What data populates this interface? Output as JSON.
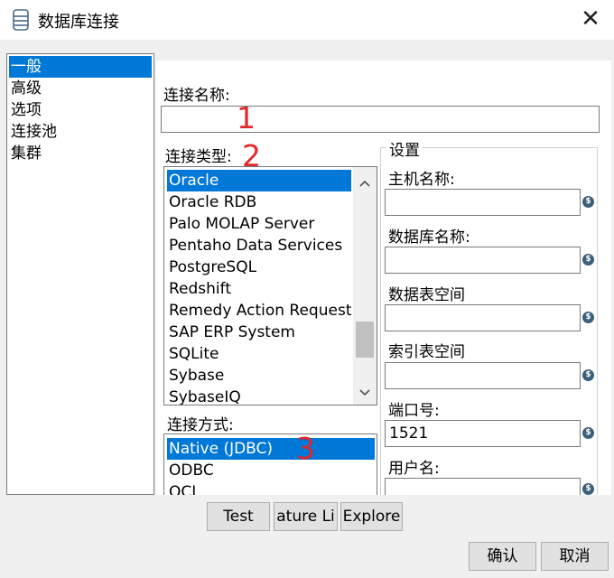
{
  "window": {
    "title": "数据库连接",
    "close_glyph": "✕"
  },
  "categories": [
    {
      "label": "一般",
      "selected": true
    },
    {
      "label": "高级",
      "selected": false
    },
    {
      "label": "选项",
      "selected": false
    },
    {
      "label": "连接池",
      "selected": false
    },
    {
      "label": "集群",
      "selected": false
    }
  ],
  "connection_name": {
    "label": "连接名称:",
    "value": ""
  },
  "connection_type": {
    "label": "连接类型:",
    "items": [
      "Oracle",
      "Oracle RDB",
      "Palo MOLAP Server",
      "Pentaho Data Services",
      "PostgreSQL",
      "Redshift",
      "Remedy Action Request System",
      "SAP ERP System",
      "SQLite",
      "Sybase",
      "SybaseIQ"
    ],
    "selected": "Oracle"
  },
  "access_method": {
    "label": "连接方式:",
    "items": [
      "Native (JDBC)",
      "ODBC",
      "OCI"
    ],
    "selected": "Native (JDBC)"
  },
  "settings": {
    "legend": "设置",
    "host_label": "主机名称:",
    "host_value": "",
    "db_label": "数据库名称:",
    "db_value": "",
    "tablespace_data_label": "数据表空间",
    "tablespace_data_value": "",
    "tablespace_index_label": "索引表空间",
    "tablespace_index_value": "",
    "port_label": "端口号:",
    "port_value": "1521",
    "user_label": "用户名:",
    "user_value": ""
  },
  "annotations": [
    "1",
    "2",
    "3"
  ],
  "buttons": {
    "test": "Test",
    "feature_list": "ature Li",
    "explore": "Explore",
    "ok": "确认",
    "cancel": "取消"
  },
  "colors": {
    "selection": "#0078d7",
    "annotation": "#e0282e",
    "dialog_bg": "#f0f0f0"
  }
}
